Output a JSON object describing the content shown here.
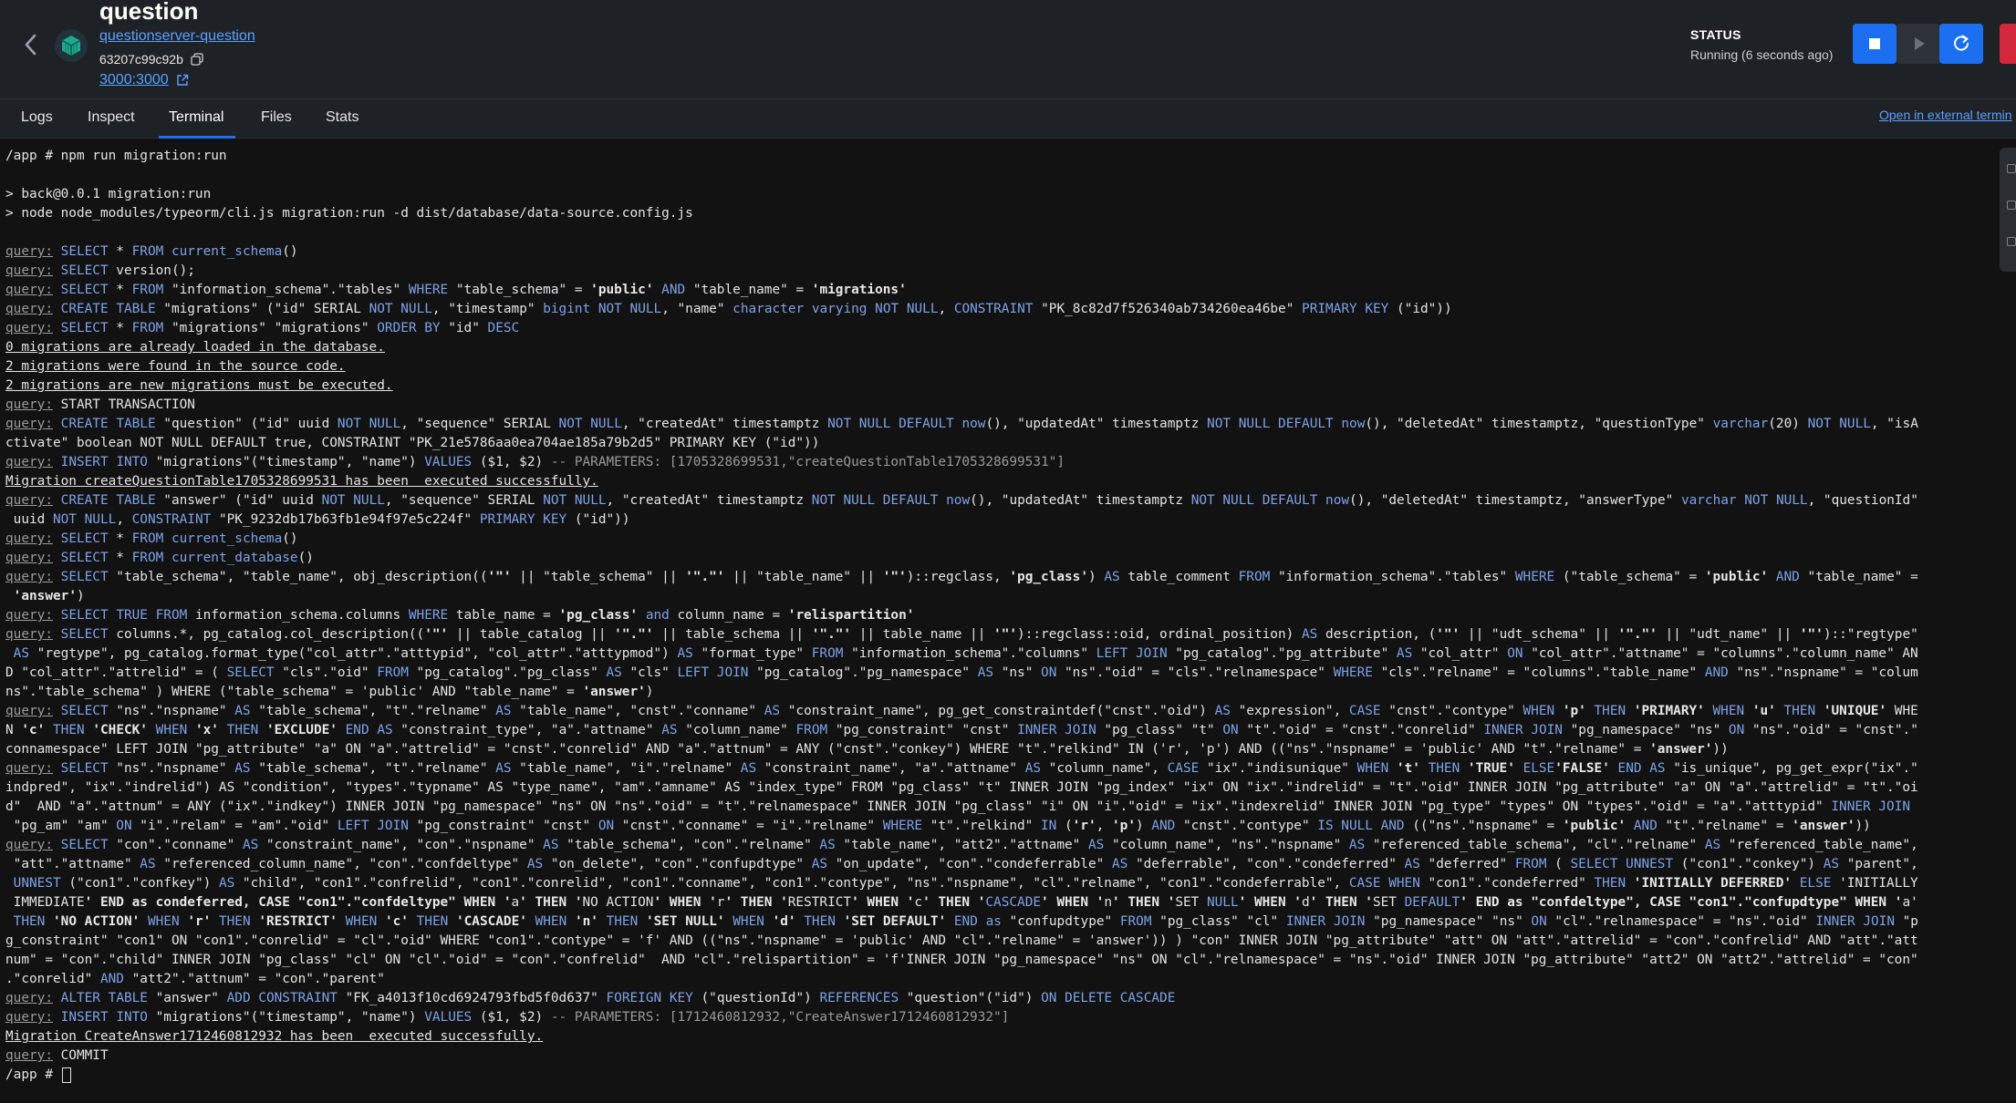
{
  "header": {
    "title": "question",
    "image_link": "questionserver-question",
    "container_id": "63207c99c92b",
    "port_link": "3000:3000",
    "status_label": "STATUS",
    "status_value": "Running (6 seconds ago)"
  },
  "tabs": [
    "Logs",
    "Inspect",
    "Terminal",
    "Files",
    "Stats"
  ],
  "active_tab": "Terminal",
  "open_external": "Open in external termin",
  "icons": {
    "back": "chevron-left-icon",
    "container": "container-cube-icon",
    "copy": "copy-icon",
    "external": "external-link-icon",
    "stop": "stop-icon",
    "play": "play-icon",
    "restart": "restart-icon"
  },
  "colors": {
    "accent": "#1c6ff0",
    "delete": "#d3273b",
    "link": "#5aa1ff",
    "container_icon": "#1fa98f"
  },
  "terminal": {
    "lines": [
      "/app # npm run migration:run",
      "",
      "> back@0.0.1 migration:run",
      "> node node_modules/typeorm/cli.js migration:run -d dist/database/data-source.config.js",
      "",
      "query: SELECT * FROM current_schema()",
      "query: SELECT version();",
      "query: SELECT * FROM \"information_schema\".\"tables\" WHERE \"table_schema\" = 'public' AND \"table_name\" = 'migrations'",
      "query: CREATE TABLE \"migrations\" (\"id\" SERIAL NOT NULL, \"timestamp\" bigint NOT NULL, \"name\" character varying NOT NULL, CONSTRAINT \"PK_8c82d7f526340ab734260ea46be\" PRIMARY KEY (\"id\"))",
      "query: SELECT * FROM \"migrations\" \"migrations\" ORDER BY \"id\" DESC",
      "0 migrations are already loaded in the database.",
      "2 migrations were found in the source code.",
      "2 migrations are new migrations must be executed.",
      "query: START TRANSACTION",
      "query: CREATE TABLE \"question\" (\"id\" uuid NOT NULL, \"sequence\" SERIAL NOT NULL, \"createdAt\" timestamptz NOT NULL DEFAULT now(), \"updatedAt\" timestamptz NOT NULL DEFAULT now(), \"deletedAt\" timestamptz, \"questionType\" varchar(20) NOT NULL, \"isA",
      "ctivate\" boolean NOT NULL DEFAULT true, CONSTRAINT \"PK_21e5786aa0ea704ae185a79b2d5\" PRIMARY KEY (\"id\"))",
      "query: INSERT INTO \"migrations\"(\"timestamp\", \"name\") VALUES ($1, $2) -- PARAMETERS: [1705328699531,\"createQuestionTable1705328699531\"]",
      "Migration createQuestionTable1705328699531 has been  executed successfully.",
      "query: CREATE TABLE \"answer\" (\"id\" uuid NOT NULL, \"sequence\" SERIAL NOT NULL, \"createdAt\" timestamptz NOT NULL DEFAULT now(), \"updatedAt\" timestamptz NOT NULL DEFAULT now(), \"deletedAt\" timestamptz, \"answerType\" varchar NOT NULL, \"questionId\"",
      " uuid NOT NULL, CONSTRAINT \"PK_9232db17b63fb1e94f97e5c224f\" PRIMARY KEY (\"id\"))",
      "query: SELECT * FROM current_schema()",
      "query: SELECT * FROM current_database()",
      "query: SELECT \"table_schema\", \"table_name\", obj_description(('\"' || \"table_schema\" || '\".\"' || \"table_name\" || '\"')::regclass, 'pg_class') AS table_comment FROM \"information_schema\".\"tables\" WHERE (\"table_schema\" = 'public' AND \"table_name\" =",
      " 'answer')",
      "query: SELECT TRUE FROM information_schema.columns WHERE table_name = 'pg_class' and column_name = 'relispartition'",
      "query: SELECT columns.*, pg_catalog.col_description(('\"' || table_catalog || '\".\"' || table_schema || '\".\"' || table_name || '\"')::regclass::oid, ordinal_position) AS description, ('\"' || \"udt_schema\" || '\".\"' || \"udt_name\" || '\"')::\"regtype\"",
      " AS \"regtype\", pg_catalog.format_type(\"col_attr\".\"atttypid\", \"col_attr\".\"atttypmod\") AS \"format_type\" FROM \"information_schema\".\"columns\" LEFT JOIN \"pg_catalog\".\"pg_attribute\" AS \"col_attr\" ON \"col_attr\".\"attname\" = \"columns\".\"column_name\" AN",
      "D \"col_attr\".\"attrelid\" = ( SELECT \"cls\".\"oid\" FROM \"pg_catalog\".\"pg_class\" AS \"cls\" LEFT JOIN \"pg_catalog\".\"pg_namespace\" AS \"ns\" ON \"ns\".\"oid\" = \"cls\".\"relnamespace\" WHERE \"cls\".\"relname\" = \"columns\".\"table_name\" AND \"ns\".\"nspname\" = \"colum",
      "ns\".\"table_schema\" ) WHERE (\"table_schema\" = 'public' AND \"table_name\" = 'answer')",
      "query: SELECT \"ns\".\"nspname\" AS \"table_schema\", \"t\".\"relname\" AS \"table_name\", \"cnst\".\"conname\" AS \"constraint_name\", pg_get_constraintdef(\"cnst\".\"oid\") AS \"expression\", CASE \"cnst\".\"contype\" WHEN 'p' THEN 'PRIMARY' WHEN 'u' THEN 'UNIQUE' WHE",
      "N 'c' THEN 'CHECK' WHEN 'x' THEN 'EXCLUDE' END AS \"constraint_type\", \"a\".\"attname\" AS \"column_name\" FROM \"pg_constraint\" \"cnst\" INNER JOIN \"pg_class\" \"t\" ON \"t\".\"oid\" = \"cnst\".\"conrelid\" INNER JOIN \"pg_namespace\" \"ns\" ON \"ns\".\"oid\" = \"cnst\".\"",
      "connamespace\" LEFT JOIN \"pg_attribute\" \"a\" ON \"a\".\"attrelid\" = \"cnst\".\"conrelid\" AND \"a\".\"attnum\" = ANY (\"cnst\".\"conkey\") WHERE \"t\".\"relkind\" IN ('r', 'p') AND ((\"ns\".\"nspname\" = 'public' AND \"t\".\"relname\" = 'answer'))",
      "query: SELECT \"ns\".\"nspname\" AS \"table_schema\", \"t\".\"relname\" AS \"table_name\", \"i\".\"relname\" AS \"constraint_name\", \"a\".\"attname\" AS \"column_name\", CASE \"ix\".\"indisunique\" WHEN 't' THEN 'TRUE' ELSE'FALSE' END AS \"is_unique\", pg_get_expr(\"ix\".\"",
      "indpred\", \"ix\".\"indrelid\") AS \"condition\", \"types\".\"typname\" AS \"type_name\", \"am\".\"amname\" AS \"index_type\" FROM \"pg_class\" \"t\" INNER JOIN \"pg_index\" \"ix\" ON \"ix\".\"indrelid\" = \"t\".\"oid\" INNER JOIN \"pg_attribute\" \"a\" ON \"a\".\"attrelid\" = \"t\".\"oi",
      "d\"  AND \"a\".\"attnum\" = ANY (\"ix\".\"indkey\") INNER JOIN \"pg_namespace\" \"ns\" ON \"ns\".\"oid\" = \"t\".\"relnamespace\" INNER JOIN \"pg_class\" \"i\" ON \"i\".\"oid\" = \"ix\".\"indexrelid\" INNER JOIN \"pg_type\" \"types\" ON \"types\".\"oid\" = \"a\".\"atttypid\" INNER JOIN",
      " \"pg_am\" \"am\" ON \"i\".\"relam\" = \"am\".\"oid\" LEFT JOIN \"pg_constraint\" \"cnst\" ON \"cnst\".\"conname\" = \"i\".\"relname\" WHERE \"t\".\"relkind\" IN ('r', 'p') AND \"cnst\".\"contype\" IS NULL AND ((\"ns\".\"nspname\" = 'public' AND \"t\".\"relname\" = 'answer'))",
      "query: SELECT \"con\".\"conname\" AS \"constraint_name\", \"con\".\"nspname\" AS \"table_schema\", \"con\".\"relname\" AS \"table_name\", \"att2\".\"attname\" AS \"column_name\", \"ns\".\"nspname\" AS \"referenced_table_schema\", \"cl\".\"relname\" AS \"referenced_table_name\",",
      " \"att\".\"attname\" AS \"referenced_column_name\", \"con\".\"confdeltype\" AS \"on_delete\", \"con\".\"confupdtype\" AS \"on_update\", \"con\".\"condeferrable\" AS \"deferrable\", \"con\".\"condeferred\" AS \"deferred\" FROM ( SELECT UNNEST (\"con1\".\"conkey\") AS \"parent\",",
      " UNNEST (\"con1\".\"confkey\") AS \"child\", \"con1\".\"confrelid\", \"con1\".\"conrelid\", \"con1\".\"conname\", \"con1\".\"contype\", \"ns\".\"nspname\", \"cl\".\"relname\", \"con1\".\"condeferrable\", CASE WHEN \"con1\".\"condeferred\" THEN 'INITIALLY DEFERRED' ELSE 'INITIALLY",
      " IMMEDIATE' END as condeferred, CASE \"con1\".\"confdeltype\" WHEN 'a' THEN 'NO ACTION' WHEN 'r' THEN 'RESTRICT' WHEN 'c' THEN 'CASCADE' WHEN 'n' THEN 'SET NULL' WHEN 'd' THEN 'SET DEFAULT' END as \"confdeltype\", CASE \"con1\".\"confupdtype\" WHEN 'a'",
      " THEN 'NO ACTION' WHEN 'r' THEN 'RESTRICT' WHEN 'c' THEN 'CASCADE' WHEN 'n' THEN 'SET NULL' WHEN 'd' THEN 'SET DEFAULT' END as \"confupdtype\" FROM \"pg_class\" \"cl\" INNER JOIN \"pg_namespace\" \"ns\" ON \"cl\".\"relnamespace\" = \"ns\".\"oid\" INNER JOIN \"p",
      "g_constraint\" \"con1\" ON \"con1\".\"conrelid\" = \"cl\".\"oid\" WHERE \"con1\".\"contype\" = 'f' AND ((\"ns\".\"nspname\" = 'public' AND \"cl\".\"relname\" = 'answer')) ) \"con\" INNER JOIN \"pg_attribute\" \"att\" ON \"att\".\"attrelid\" = \"con\".\"confrelid\" AND \"att\".\"att",
      "num\" = \"con\".\"child\" INNER JOIN \"pg_class\" \"cl\" ON \"cl\".\"oid\" = \"con\".\"confrelid\"  AND \"cl\".\"relispartition\" = 'f'INNER JOIN \"pg_namespace\" \"ns\" ON \"cl\".\"relnamespace\" = \"ns\".\"oid\" INNER JOIN \"pg_attribute\" \"att2\" ON \"att2\".\"attrelid\" = \"con\"",
      ".\"conrelid\" AND \"att2\".\"attnum\" = \"con\".\"parent\"",
      "query: ALTER TABLE \"answer\" ADD CONSTRAINT \"FK_a4013f10cd6924793fbd5f0d637\" FOREIGN KEY (\"questionId\") REFERENCES \"question\"(\"id\") ON DELETE CASCADE",
      "query: INSERT INTO \"migrations\"(\"timestamp\", \"name\") VALUES ($1, $2) -- PARAMETERS: [1712460812932,\"CreateAnswer1712460812932\"]",
      "Migration CreateAnswer1712460812932 has been  executed successfully.",
      "query: COMMIT",
      "/app # "
    ]
  }
}
